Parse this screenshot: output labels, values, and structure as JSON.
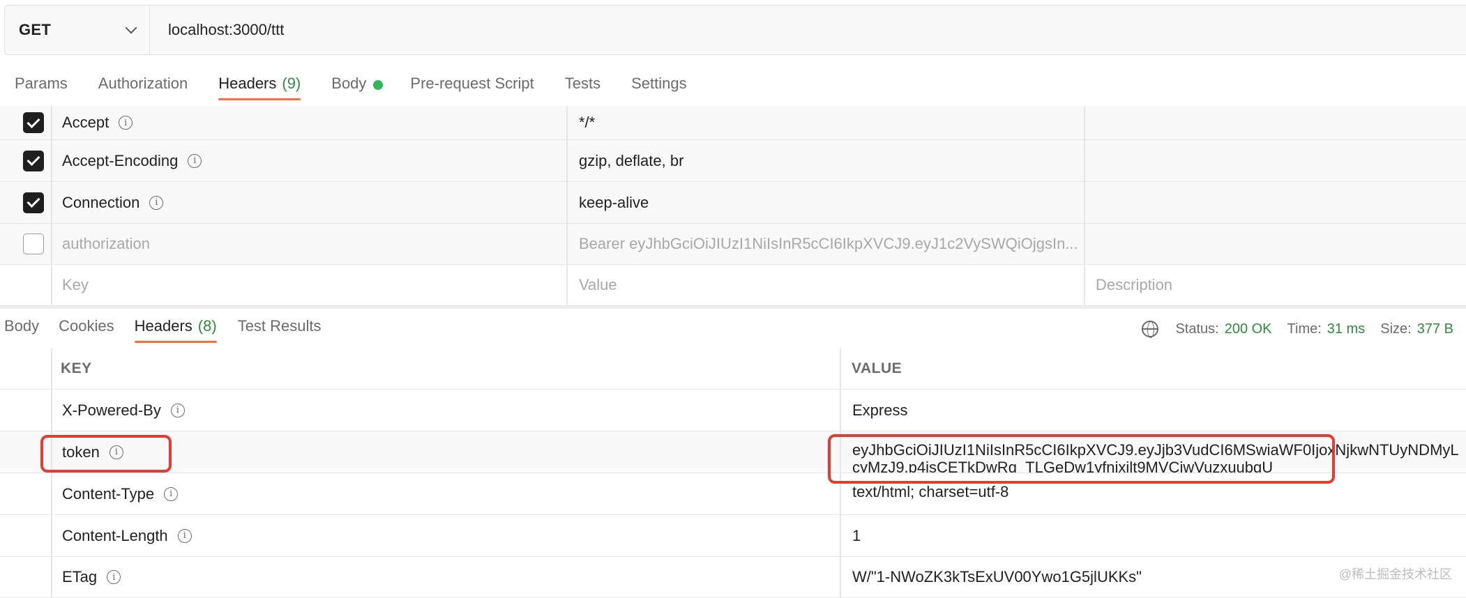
{
  "request": {
    "method": "GET",
    "url": "localhost:3000/ttt",
    "tabs": [
      {
        "label": "Params"
      },
      {
        "label": "Authorization"
      },
      {
        "label": "Headers",
        "count": "(9)"
      },
      {
        "label": "Body"
      },
      {
        "label": "Pre-request Script"
      },
      {
        "label": "Tests"
      },
      {
        "label": "Settings"
      }
    ],
    "headers": [
      {
        "key": "Accept",
        "value": "*/*"
      },
      {
        "key": "Accept-Encoding",
        "value": "gzip, deflate, br"
      },
      {
        "key": "Connection",
        "value": "keep-alive"
      },
      {
        "key": "authorization",
        "value": "Bearer eyJhbGciOiJIUzI1NiIsInR5cCI6IkpXVCJ9.eyJ1c2VySWQiOjgsIn..."
      }
    ],
    "placeholders": {
      "key": "Key",
      "value": "Value",
      "description": "Description"
    }
  },
  "response": {
    "tabs": [
      {
        "label": "Body"
      },
      {
        "label": "Cookies"
      },
      {
        "label": "Headers",
        "count": "(8)"
      },
      {
        "label": "Test Results"
      }
    ],
    "status_label": "Status:",
    "status": "200 OK",
    "time_label": "Time:",
    "time": "31 ms",
    "size_label": "Size:",
    "size": "377 B",
    "columns": {
      "key": "KEY",
      "value": "VALUE"
    },
    "headers": [
      {
        "key": "X-Powered-By",
        "value": "Express"
      },
      {
        "key": "token",
        "value_line1": "eyJhbGciOiJIUzI1NiIsInR5cCI6IkpXVCJ9.eyJjb3VudCI6MSwiaWF0IjoxNjkwNTUyNDMyL",
        "value_line2": "cyMzJ9.p4isCETkDwRq_TLGeDw1yfnixilt9MVCiwVuzxuubgU"
      },
      {
        "key": "Content-Type",
        "value": "text/html; charset=utf-8"
      },
      {
        "key": "Content-Length",
        "value": "1"
      },
      {
        "key": "ETag",
        "value": "W/\"1-NWoZK3kTsExUV00Ywo1G5jlUKKs\""
      }
    ]
  },
  "info_glyph": "i",
  "watermark": "@稀土掘金技术社区",
  "colors": {
    "accent": "#ff6c37",
    "success": "#2e8b3d",
    "dot": "#2fb65a",
    "highlight": "#e53b31"
  }
}
